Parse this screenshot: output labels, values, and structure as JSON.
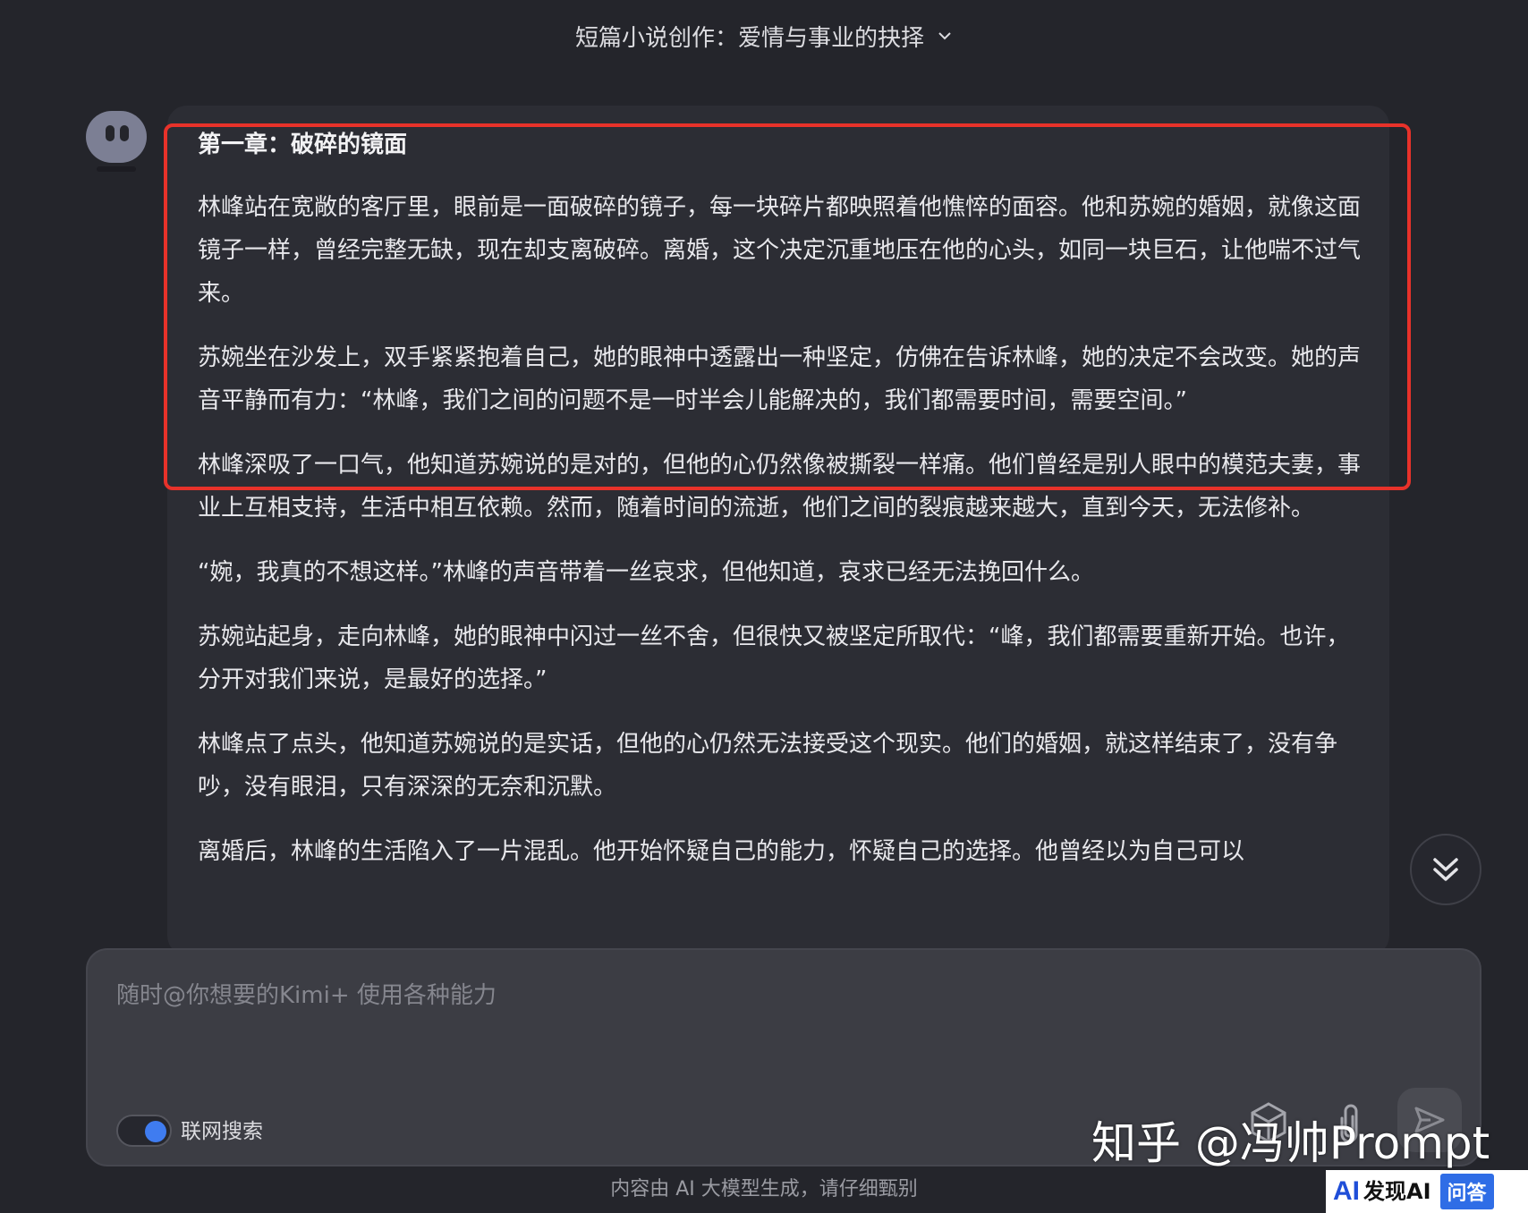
{
  "header": {
    "title": "短篇小说创作：爱情与事业的抉择"
  },
  "message": {
    "chapter_title": "第一章：破碎的镜面",
    "paragraphs": [
      "林峰站在宽敞的客厅里，眼前是一面破碎的镜子，每一块碎片都映照着他憔悴的面容。他和苏婉的婚姻，就像这面镜子一样，曾经完整无缺，现在却支离破碎。离婚，这个决定沉重地压在他的心头，如同一块巨石，让他喘不过气来。",
      "苏婉坐在沙发上，双手紧紧抱着自己，她的眼神中透露出一种坚定，仿佛在告诉林峰，她的决定不会改变。她的声音平静而有力：“林峰，我们之间的问题不是一时半会儿能解决的，我们都需要时间，需要空间。”",
      "林峰深吸了一口气，他知道苏婉说的是对的，但他的心仍然像被撕裂一样痛。他们曾经是别人眼中的模范夫妻，事业上互相支持，生活中相互依赖。然而，随着时间的流逝，他们之间的裂痕越来越大，直到今天，无法修补。",
      "“婉，我真的不想这样。”林峰的声音带着一丝哀求，但他知道，哀求已经无法挽回什么。",
      "苏婉站起身，走向林峰，她的眼神中闪过一丝不舍，但很快又被坚定所取代：“峰，我们都需要重新开始。也许，分开对我们来说，是最好的选择。”",
      "林峰点了点头，他知道苏婉说的是实话，但他的心仍然无法接受这个现实。他们的婚姻，就这样结束了，没有争吵，没有眼泪，只有深深的无奈和沉默。",
      "离婚后，林峰的生活陷入了一片混乱。他开始怀疑自己的能力，怀疑自己的选择。他曾经以为自己可以"
    ]
  },
  "input": {
    "placeholder": "随时@你想要的Kimi+ 使用各种能力",
    "value": ""
  },
  "toggle": {
    "label": "联网搜索",
    "on": true
  },
  "footer": {
    "disclaimer": "内容由 AI 大模型生成，请仔细甄别"
  },
  "watermark": {
    "text": "知乎 @冯帅Prompt"
  },
  "logo": {
    "ai": "AI",
    "cn": "发现AI",
    "qa": "问答"
  },
  "colors": {
    "accent": "#3f7cf0",
    "highlight": "#e8322a",
    "background": "#24252b"
  }
}
